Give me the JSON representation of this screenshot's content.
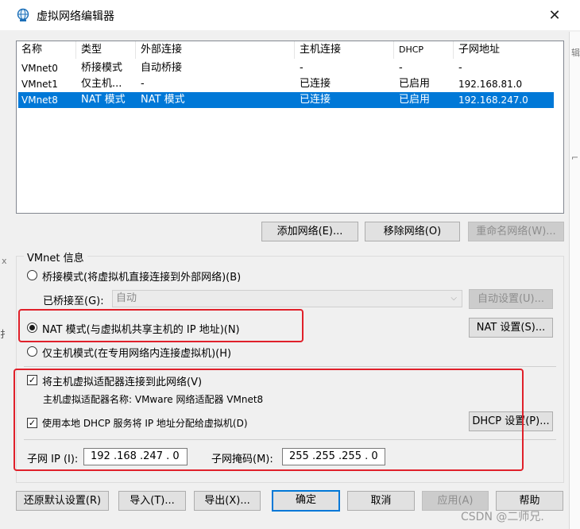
{
  "window": {
    "title": "虚拟网络编辑器",
    "close_glyph": "✕"
  },
  "background_glyphs": [
    "辑",
    "⌐",
    "x",
    "扌"
  ],
  "table": {
    "headers": [
      "名称",
      "类型",
      "外部连接",
      "主机连接",
      "DHCP",
      "子网地址"
    ],
    "rows": [
      [
        "VMnet0",
        "桥接模式",
        "自动桥接",
        "-",
        "-",
        "-"
      ],
      [
        "VMnet1",
        "仅主机...",
        "-",
        "已连接",
        "已启用",
        "192.168.81.0"
      ],
      [
        "VMnet8",
        "NAT 模式",
        "NAT 模式",
        "已连接",
        "已启用",
        "192.168.247.0"
      ]
    ],
    "selected_row": 2
  },
  "list_buttons": {
    "add": "添加网络(E)...",
    "remove": "移除网络(O)",
    "rename": "重命名网络(W)..."
  },
  "vmnet_info": {
    "label": "VMnet 信息",
    "bridged_radio": "桥接模式(将虚拟机直接连接到外部网络)(B)",
    "bridged_to_label": "已桥接至(G):",
    "bridged_to_value": "自动",
    "auto_settings": "自动设置(U)...",
    "nat_radio": "NAT 模式(与虚拟机共享主机的 IP 地址)(N)",
    "nat_settings": "NAT 设置(S)...",
    "hostonly_radio": "仅主机模式(在专用网络内连接虚拟机)(H)",
    "connect_adapter_check": "将主机虚拟适配器连接到此网络(V)",
    "adapter_name": "主机虚拟适配器名称: VMware 网络适配器 VMnet8",
    "dhcp_check": "使用本地 DHCP 服务将 IP 地址分配给虚拟机(D)",
    "dhcp_settings": "DHCP 设置(P)...",
    "subnet_ip_label": "子网 IP (I):",
    "subnet_ip_value": "192 .168 .247 .  0",
    "subnet_mask_label": "子网掩码(M):",
    "subnet_mask_value": "255 .255 .255 .  0"
  },
  "bottom_buttons": {
    "restore": "还原默认设置(R)",
    "import": "导入(T)...",
    "export": "导出(X)...",
    "ok": "确定",
    "cancel": "取消",
    "apply": "应用(A)",
    "help": "帮助"
  },
  "watermark": "CSDN @二师兄.",
  "colors": {
    "selection": "#0078d7",
    "highlight": "#e0202a"
  }
}
